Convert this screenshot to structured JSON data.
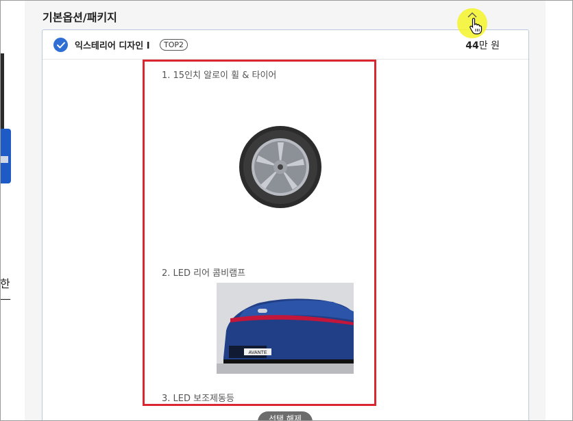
{
  "section": {
    "title": "기본옵션/패키지"
  },
  "left_partial": {
    "text": "한\n—"
  },
  "option": {
    "name": "익스테리어 디자인 I",
    "badge": "TOP2",
    "price_amount": "44",
    "price_unit": "만 원",
    "selected": true
  },
  "items": [
    {
      "label": "1. 15인치 알로이 휠 & 타이어"
    },
    {
      "label": "2. LED 리어 콤비램프"
    },
    {
      "label": "3. LED 보조제동등"
    }
  ],
  "car_badge_text": "AVANTE",
  "toggle_button": {
    "label": "선택 해제"
  },
  "colors": {
    "accent_blue": "#2f6fd4",
    "highlight_red": "#d9262f",
    "cursor_highlight": "#f3f32a"
  },
  "icons": [
    "check-icon",
    "chevron-up-icon",
    "hand-cursor-icon"
  ]
}
